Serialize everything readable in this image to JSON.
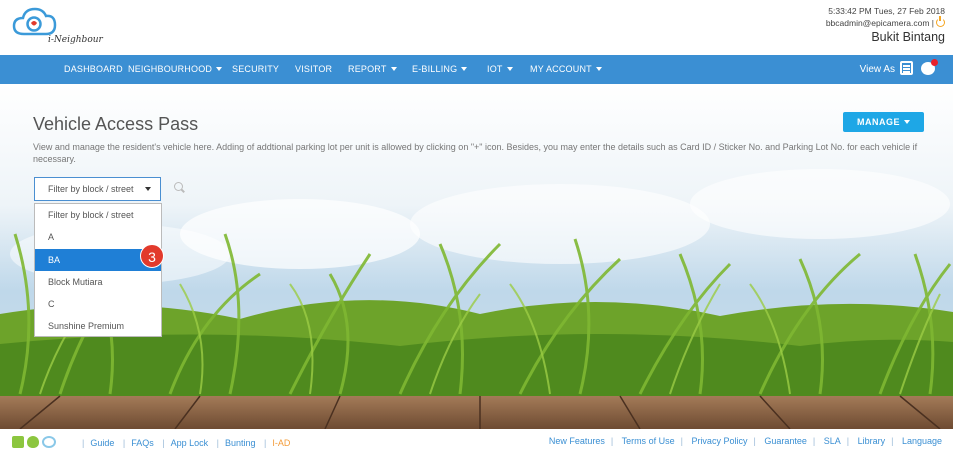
{
  "header": {
    "logo_text": "i-Neighbour",
    "datetime": "5:33:42 PM Tues, 27 Feb 2018",
    "email": "bbcadmin@epicamera.com |",
    "location": "Bukit Bintang"
  },
  "nav": {
    "items": [
      {
        "label": "DASHBOARD",
        "dropdown": false
      },
      {
        "label": "NEIGHBOURHOOD",
        "dropdown": true
      },
      {
        "label": "SECURITY",
        "dropdown": false
      },
      {
        "label": "VISITOR",
        "dropdown": false
      },
      {
        "label": "REPORT",
        "dropdown": true
      },
      {
        "label": "E-BILLING",
        "dropdown": true
      },
      {
        "label": "IOT",
        "dropdown": true
      },
      {
        "label": "MY ACCOUNT",
        "dropdown": true
      }
    ],
    "view_as": "View As"
  },
  "main": {
    "title": "Vehicle Access Pass",
    "description": "View and manage the resident's vehicle here. Adding of addtional parking lot per unit is allowed by clicking on \"+\" icon. Besides, you may enter the details such as Card ID / Sticker No. and Parking Lot No. for each vehicle if necessary.",
    "manage_label": "MANAGE",
    "filter": {
      "selected": "Filter by block / street",
      "options": [
        "Filter by block / street",
        "A",
        "BA",
        "Block Mutiara",
        "C",
        "Sunshine Premium"
      ],
      "highlighted": "BA"
    },
    "step_badge": "3"
  },
  "footer": {
    "left_links": [
      "Guide",
      "FAQs",
      "App Lock",
      "Bunting",
      "I-AD"
    ],
    "right_links": [
      "New Features",
      "Terms of Use",
      "Privacy Policy",
      "Guarantee",
      "SLA",
      "Library",
      "Language"
    ]
  },
  "colors": {
    "nav_bg": "#3b8fd3",
    "manage_btn": "#1ea7e6",
    "selected_option": "#1f7fd6",
    "badge": "#e23a2c"
  },
  "icons": [
    "cloud-logo-icon",
    "power-icon",
    "list-icon",
    "chat-icon",
    "search-icon",
    "android-icon",
    "apple-icon",
    "cloud-icon"
  ]
}
